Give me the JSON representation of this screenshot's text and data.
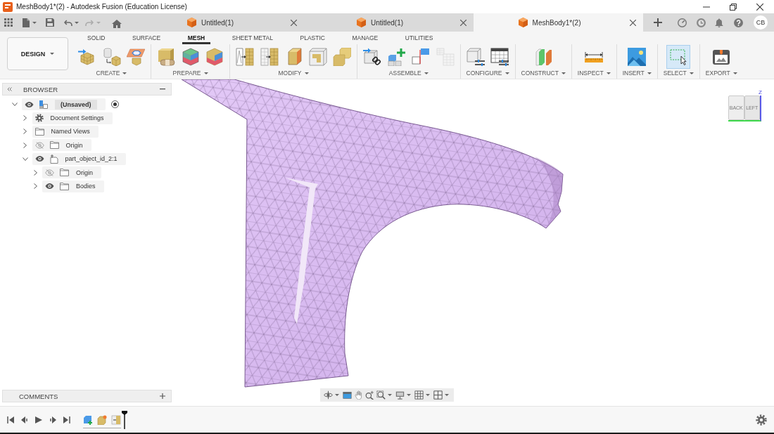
{
  "window": {
    "title": "MeshBody1*(2) - Autodesk Fusion (Education License)"
  },
  "document_tabs": [
    {
      "label": "Untitled(1)",
      "selected": false
    },
    {
      "label": "Untitled(1)",
      "selected": false
    },
    {
      "label": "MeshBody1*(2)",
      "selected": true
    }
  ],
  "user": {
    "initials": "CB"
  },
  "workspace": {
    "label": "DESIGN"
  },
  "toolbar_tabs": [
    {
      "label": "SOLID",
      "selected": false
    },
    {
      "label": "SURFACE",
      "selected": false
    },
    {
      "label": "MESH",
      "selected": true
    },
    {
      "label": "SHEET METAL",
      "selected": false
    },
    {
      "label": "PLASTIC",
      "selected": false
    },
    {
      "label": "MANAGE",
      "selected": false
    },
    {
      "label": "UTILITIES",
      "selected": false
    }
  ],
  "tool_groups": [
    {
      "label": "CREATE",
      "tools": [
        {
          "active": false,
          "disabled": false
        },
        {
          "active": false,
          "disabled": false
        },
        {
          "active": false,
          "disabled": false
        }
      ]
    },
    {
      "label": "PREPARE",
      "tools": [
        {
          "active": false,
          "disabled": false
        },
        {
          "active": false,
          "disabled": false
        },
        {
          "active": false,
          "disabled": false
        }
      ]
    },
    {
      "label": "MODIFY",
      "tools": [
        {
          "active": false,
          "disabled": false
        },
        {
          "active": false,
          "disabled": false
        },
        {
          "active": false,
          "disabled": false
        },
        {
          "active": false,
          "disabled": false
        },
        {
          "active": false,
          "disabled": false
        }
      ]
    },
    {
      "label": "ASSEMBLE",
      "tools": [
        {
          "active": false,
          "disabled": false
        },
        {
          "active": false,
          "disabled": false
        },
        {
          "active": false,
          "disabled": false
        },
        {
          "active": false,
          "disabled": true
        }
      ]
    },
    {
      "label": "CONFIGURE",
      "tools": [
        {
          "active": false,
          "disabled": false
        },
        {
          "active": false,
          "disabled": false
        }
      ]
    },
    {
      "label": "CONSTRUCT",
      "tools": [
        {
          "active": false,
          "disabled": false
        }
      ]
    },
    {
      "label": "INSPECT",
      "tools": [
        {
          "active": false,
          "disabled": false
        }
      ]
    },
    {
      "label": "INSERT",
      "tools": [
        {
          "active": false,
          "disabled": false
        }
      ]
    },
    {
      "label": "SELECT",
      "tools": [
        {
          "active": true,
          "disabled": false
        }
      ]
    },
    {
      "label": "EXPORT",
      "tools": [
        {
          "active": false,
          "disabled": false
        }
      ]
    }
  ],
  "browser": {
    "title": "BROWSER",
    "tree": [
      {
        "label": "(Unsaved)",
        "kind": "document",
        "expanded": true,
        "visible": true,
        "active": true,
        "children": [
          {
            "label": "Document Settings",
            "kind": "settings",
            "expanded": false
          },
          {
            "label": "Named Views",
            "kind": "folder",
            "expanded": false
          },
          {
            "label": "Origin",
            "kind": "folder",
            "expanded": false,
            "visible": false
          },
          {
            "label": "part_object_id_2:1",
            "kind": "component",
            "expanded": true,
            "visible": true,
            "children": [
              {
                "label": "Origin",
                "kind": "folder",
                "expanded": false,
                "visible": false
              },
              {
                "label": "Bodies",
                "kind": "folder",
                "expanded": false,
                "visible": true
              }
            ]
          }
        ]
      }
    ]
  },
  "view_cube": {
    "faces": [
      "BACK",
      "LEFT"
    ],
    "axis": "Z"
  },
  "comments": {
    "title": "COMMENTS"
  }
}
